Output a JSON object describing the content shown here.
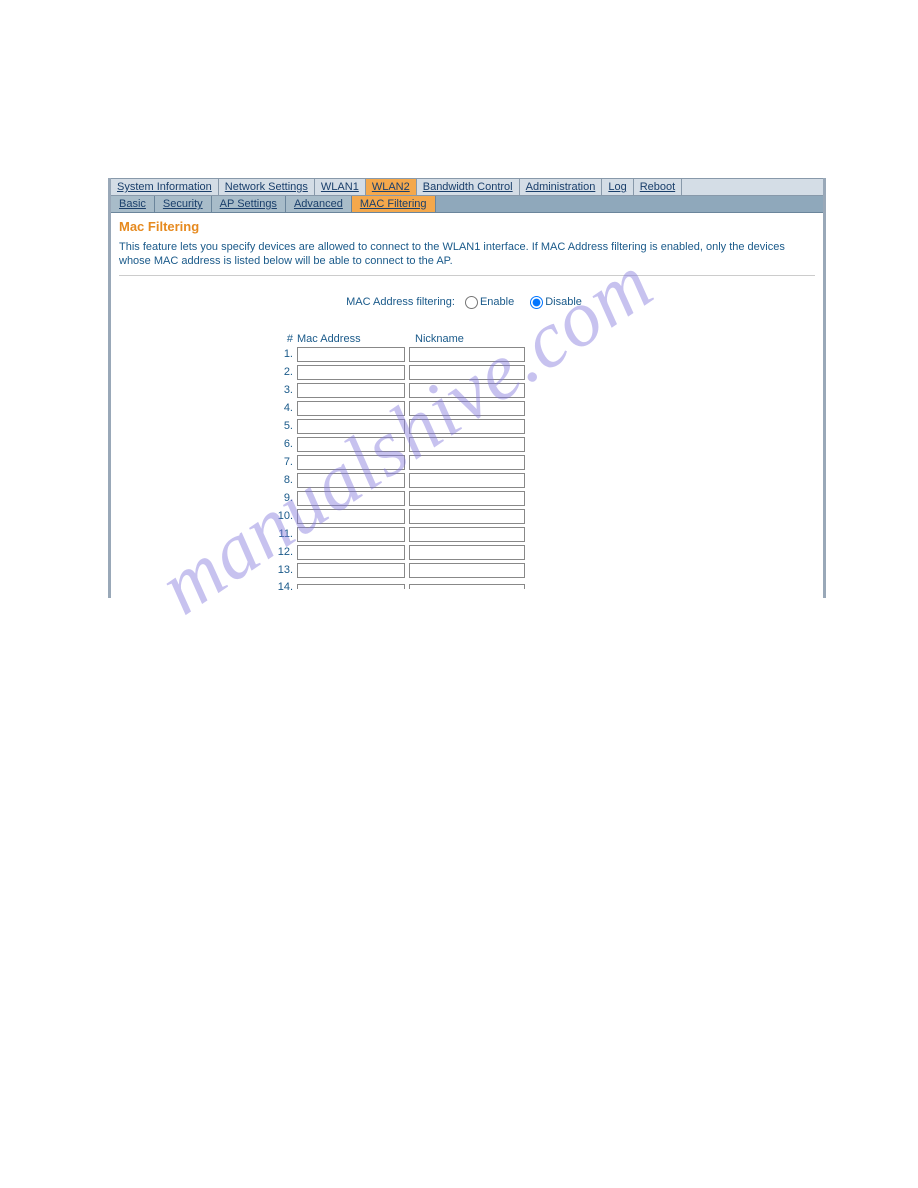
{
  "topTabs": [
    {
      "label": "System Information",
      "active": false
    },
    {
      "label": "Network Settings",
      "active": false
    },
    {
      "label": "WLAN1",
      "active": false
    },
    {
      "label": "WLAN2",
      "active": true
    },
    {
      "label": "Bandwidth Control",
      "active": false
    },
    {
      "label": "Administration",
      "active": false
    },
    {
      "label": "Log",
      "active": false
    },
    {
      "label": "Reboot",
      "active": false
    }
  ],
  "subTabs": [
    {
      "label": "Basic",
      "active": false
    },
    {
      "label": "Security",
      "active": false
    },
    {
      "label": "AP Settings",
      "active": false
    },
    {
      "label": "Advanced",
      "active": false
    },
    {
      "label": "MAC Filtering",
      "active": true
    }
  ],
  "page": {
    "title": "Mac Filtering",
    "description": "This feature lets you specify devices are allowed to connect to the WLAN1 interface. If MAC Address filtering is enabled, only the devices whose MAC address is listed below will be able to connect to the AP."
  },
  "filter": {
    "label": "MAC Address filtering:",
    "enableLabel": "Enable",
    "disableLabel": "Disable",
    "selected": "disable"
  },
  "tableHeaders": {
    "num": "#",
    "mac": "Mac Address",
    "nick": "Nickname"
  },
  "rows": [
    {
      "num": "1.",
      "mac": "",
      "nick": ""
    },
    {
      "num": "2.",
      "mac": "",
      "nick": ""
    },
    {
      "num": "3.",
      "mac": "",
      "nick": ""
    },
    {
      "num": "4.",
      "mac": "",
      "nick": ""
    },
    {
      "num": "5.",
      "mac": "",
      "nick": ""
    },
    {
      "num": "6.",
      "mac": "",
      "nick": ""
    },
    {
      "num": "7.",
      "mac": "",
      "nick": ""
    },
    {
      "num": "8.",
      "mac": "",
      "nick": ""
    },
    {
      "num": "9.",
      "mac": "",
      "nick": ""
    },
    {
      "num": "10.",
      "mac": "",
      "nick": ""
    },
    {
      "num": "11.",
      "mac": "",
      "nick": ""
    },
    {
      "num": "12.",
      "mac": "",
      "nick": ""
    },
    {
      "num": "13.",
      "mac": "",
      "nick": ""
    },
    {
      "num": "14.",
      "mac": "",
      "nick": ""
    }
  ],
  "watermark": "manualshive.com"
}
